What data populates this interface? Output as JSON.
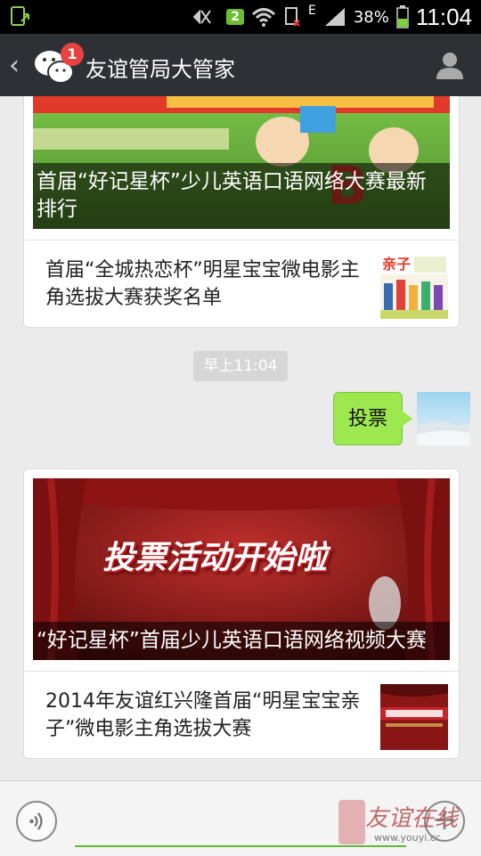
{
  "status_bar": {
    "notification_badge": "2",
    "network": "E",
    "battery_percent": "38%",
    "time": "11:04"
  },
  "header": {
    "back_label": "‹",
    "unread_count": "1",
    "title": "友谊管局大管家"
  },
  "messages": {
    "card1": {
      "cover_caption": "首届“好记星杯”少儿英语口语网络大赛最新排行",
      "item_title": "首届“全城热恋杯”明星宝宝微电影主角选拔大赛获奖名单"
    },
    "timestamp": "早上11:04",
    "sent_text": "投票",
    "card2": {
      "cover_banner": "投票活动开始啦",
      "cover_caption": "“好记星杯”首届少儿英语口语网络视频大赛",
      "item_title": "2014年友谊红兴隆首届“明星宝宝亲子”微电影主角选拔大赛"
    }
  },
  "bottom_bar": {
    "plus_label": "+"
  },
  "watermark": {
    "text": "友谊在线",
    "url": "www.youyi.cc"
  },
  "colors": {
    "titlebar": "#2d3135",
    "bubble": "#9ee84f",
    "badge": "#e64340",
    "accent_line": "#5dbb32"
  }
}
